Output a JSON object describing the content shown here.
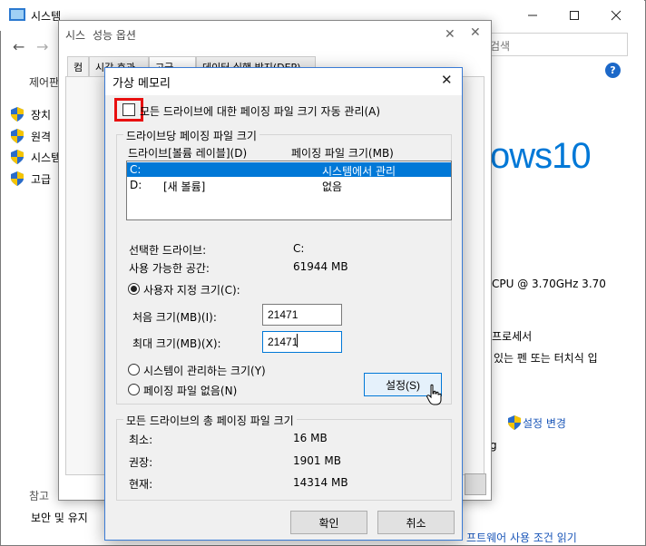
{
  "system_window": {
    "title": "시스템",
    "search_placeholder": "검색",
    "sidebar": {
      "home": "제어판",
      "items": [
        "장치",
        "원격",
        "시스템",
        "고급"
      ],
      "ref_label": "참고",
      "bottom_link": "보안 및 유지"
    },
    "brand_text": "ows10",
    "cpu_text": "CPU @ 3.70GHz   3.70",
    "processor_text": "프로세서",
    "pen_text": "있는 펜 또는 터치식 입",
    "settings_change": "설정 변경",
    "license_link": "프트웨어 사용 조건 읽기",
    "misc_fragment": "g"
  },
  "perf_window": {
    "title": "성능 옵션",
    "behind_title": "시스",
    "tabs": [
      "시각 효과",
      "고급",
      "데이터 실행 방지(DEP)"
    ],
    "tab_prefix": "컴"
  },
  "vm_dialog": {
    "title": "가상 메모리",
    "auto_manage_label": "모든 드라이브에 대한 페이징 파일 크기 자동 관리(A)",
    "auto_manage_checked": false,
    "per_drive_group_title": "드라이브당 페이징 파일 크기",
    "header_drive": "드라이브[볼륨 레이블](D)",
    "header_size": "페이징 파일 크기(MB)",
    "drives": [
      {
        "drive": "C:",
        "label": "",
        "size": "시스템에서 관리",
        "selected": true
      },
      {
        "drive": "D:",
        "label": "[새 볼륨]",
        "size": "없음",
        "selected": false
      }
    ],
    "selected_drive_label": "선택한 드라이브:",
    "selected_drive_value": "C:",
    "available_space_label": "사용 가능한 공간:",
    "available_space_value": "61944 MB",
    "custom_size_label": "사용자 지정 크기(C):",
    "initial_size_label": "처음 크기(MB)(I):",
    "initial_size_value": "21471",
    "max_size_label": "최대 크기(MB)(X):",
    "max_size_value": "21471",
    "system_managed_label": "시스템이 관리하는 크기(Y)",
    "no_paging_label": "페이징 파일 없음(N)",
    "set_button": "설정(S)",
    "total_group_title": "모든 드라이브의 총 페이징 파일 크기",
    "min_label": "최소:",
    "min_value": "16 MB",
    "recommended_label": "권장:",
    "recommended_value": "1901 MB",
    "current_label": "현재:",
    "current_value": "14314 MB",
    "ok_button": "확인",
    "cancel_button": "취소"
  },
  "colors": {
    "accent": "#0078d7",
    "highlight": "#e81010",
    "brand_blue": "#0078d7"
  }
}
